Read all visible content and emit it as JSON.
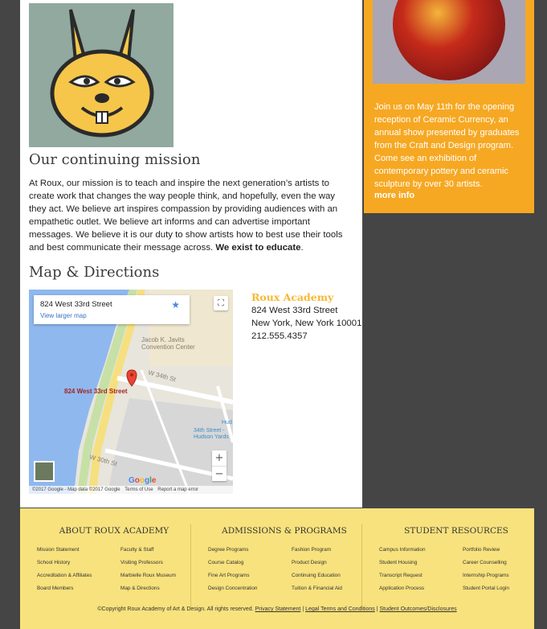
{
  "mission": {
    "title": "Our continuing mission",
    "text": "At Roux, our mission is to teach and inspire the next generation’s artists to create work that changes the way people think, and hopefully, even the way they act. We believe art inspires compassion by providing audiences with an empathetic outlet. We believe art informs and can advertise important messages. We believe it is our duty to show artists how to best use their tools and best communicate their message across.",
    "emphasis": "We exist to educate",
    "period": "."
  },
  "map_section": {
    "title": "Map & Directions",
    "card_title": "824 West 33rd Street",
    "card_link": "View larger map",
    "pin_label": "824 West 33rd Street",
    "poi_javits": "Jacob K. Javits\nConvention Center",
    "poi_station": "34th Street -\nHudson Yards",
    "street_34": "W 34th St",
    "street_30": "W 30th St",
    "hud": "Hud",
    "logo": "Google",
    "footer_data": "©2017 Google - Map data ©2017 Google",
    "footer_terms": "Terms of Use",
    "footer_report": "Report a map error",
    "zoom_in": "+",
    "zoom_out": "−"
  },
  "address": {
    "name": "Roux Academy",
    "line1": "824 West 33rd Street",
    "line2": "New York, New York 10001",
    "phone": "212.555.4357"
  },
  "promo": {
    "text": "Join us on May 11th for the opening reception of Ceramic Currency, an annual show presented by graduates from the Craft and Design program. Come see an exhibition of contemporary pottery and ceramic sculpture by over 30 artists.",
    "link": "more info"
  },
  "footer": {
    "columns": [
      {
        "title": "ABOUT ROUX ACADEMY",
        "left": [
          "Mission Statement",
          "School History",
          "Accreditation & Affiliates",
          "Board Members"
        ],
        "right": [
          "Faculty & Staff",
          "Visiting Professors",
          "Marbielle Roux Museum",
          "Map & Directions"
        ]
      },
      {
        "title": "ADMISSIONS & PROGRAMS",
        "left": [
          "Degree Programs",
          "Course Catalog",
          "Fine Art Programs",
          "Design Concentration"
        ],
        "right": [
          "Fashion Program",
          "Product Design",
          "Continuing Education",
          "Tuition & Financial Aid"
        ]
      },
      {
        "title": "STUDENT RESOURCES",
        "left": [
          "Campus Information",
          "Student Housing",
          "Transcript Request",
          "Application Process"
        ],
        "right": [
          "Portfolio Review",
          "Internship Programs",
          "Student Portal Login"
        ]
      }
    ],
    "copyright": "©Copyright Roux Academy of Art & Design. All rights reserved.",
    "privacy": "Privacy Statement",
    "legal": "Legal Terms and Conditions",
    "outcomes": "Student Outcomes/Disclosures",
    "sep": "|",
    "counselling": "Career Counselling"
  }
}
